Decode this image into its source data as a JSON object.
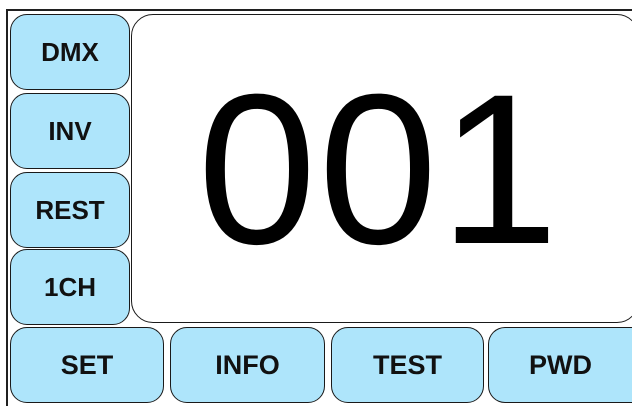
{
  "side_menu": {
    "items": [
      {
        "label": "DMX"
      },
      {
        "label": "INV"
      },
      {
        "label": "REST"
      },
      {
        "label": "1CH"
      }
    ]
  },
  "display": {
    "value": "001"
  },
  "bottom_menu": {
    "items": [
      {
        "label": "SET"
      },
      {
        "label": "INFO"
      },
      {
        "label": "TEST"
      },
      {
        "label": "PWD"
      }
    ]
  },
  "colors": {
    "button_fill": "#aee5fb",
    "button_border": "#1a1a1a",
    "background": "#ffffff",
    "text": "#111111"
  }
}
